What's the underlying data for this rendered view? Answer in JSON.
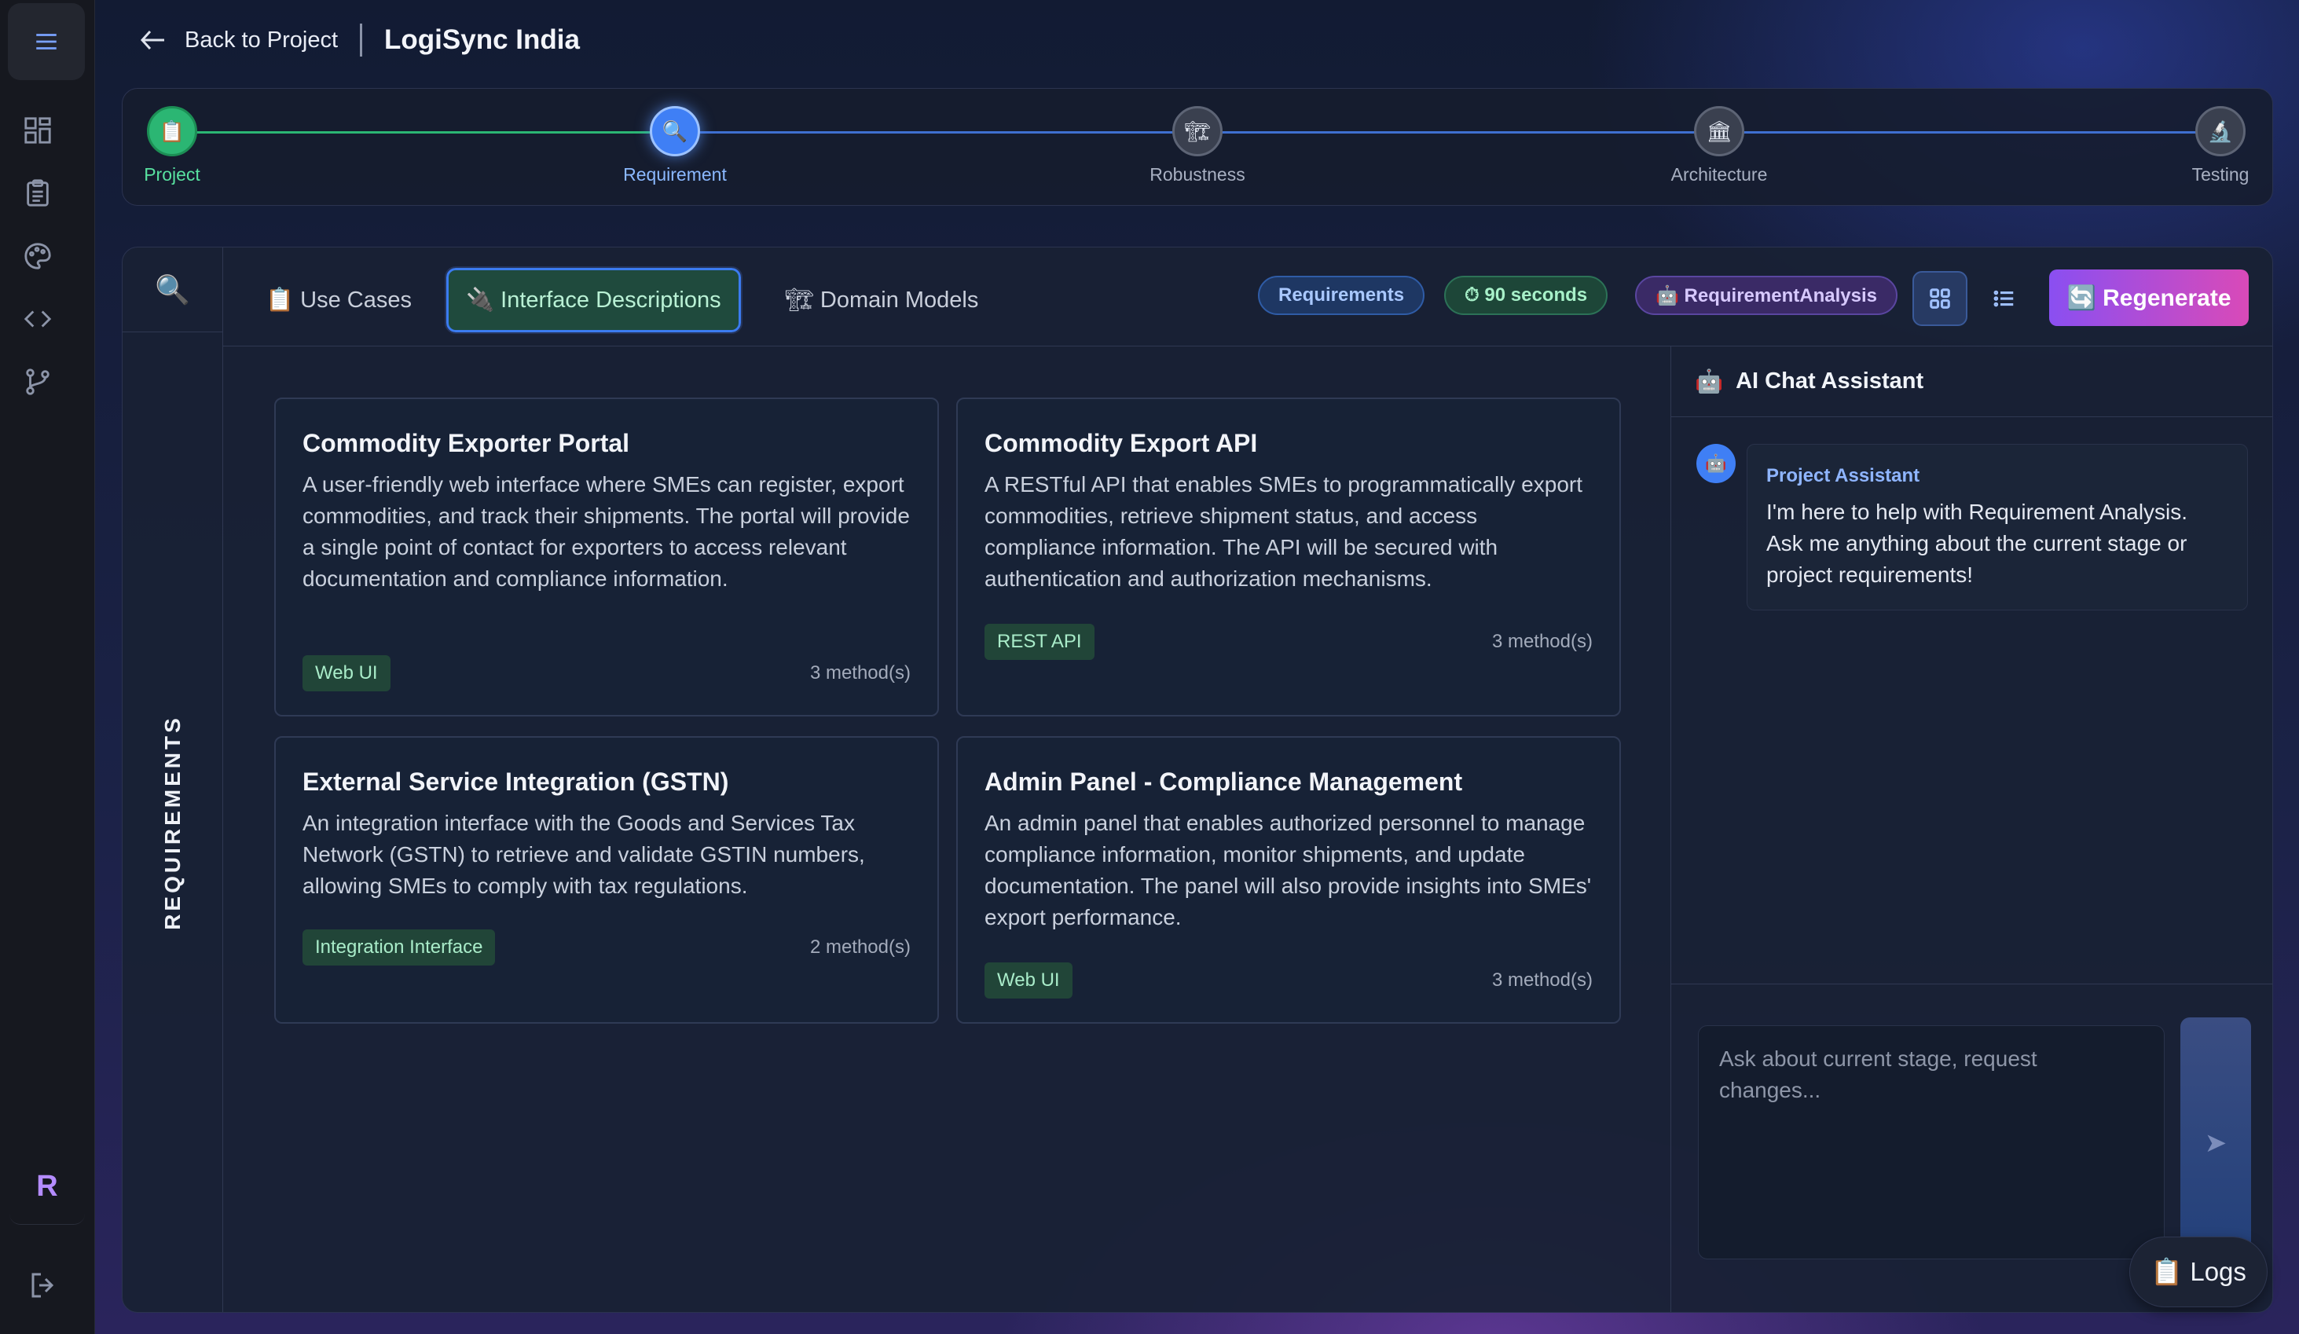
{
  "header": {
    "back_label": "Back to Project",
    "project_title": "LogiSync India"
  },
  "stepper": {
    "steps": [
      {
        "label": "Project",
        "icon": "📋",
        "state": "done"
      },
      {
        "label": "Requirement",
        "icon": "🔍",
        "state": "active"
      },
      {
        "label": "Robustness",
        "icon": "🏗",
        "state": "pending"
      },
      {
        "label": "Architecture",
        "icon": "🏛",
        "state": "pending"
      },
      {
        "label": "Testing",
        "icon": "🔬",
        "state": "pending"
      }
    ]
  },
  "sidebar": {
    "avatar_letter": "R"
  },
  "panel": {
    "vertical_label": "REQUIREMENTS",
    "search_icon": "🔍",
    "tabs": [
      {
        "icon": "📋",
        "label": "Use Cases"
      },
      {
        "icon": "🔌",
        "label": "Interface Descriptions"
      },
      {
        "icon": "🏗",
        "label": "Domain Models"
      }
    ],
    "badges": {
      "requirements": "Requirements",
      "time": "⏱ 90 seconds",
      "analysis": "🤖 RequirementAnalysis"
    },
    "regenerate_label": "🔄 Regenerate"
  },
  "cards": [
    {
      "title": "Commodity Exporter Portal",
      "description": "A user-friendly web interface where SMEs can register, export commodities, and track their shipments. The portal will provide a single point of contact for exporters to access relevant documentation and compliance information.",
      "tag": "Web UI",
      "methods": "3 method(s)"
    },
    {
      "title": "Commodity Export API",
      "description": "A RESTful API that enables SMEs to programmatically export commodities, retrieve shipment status, and access compliance information. The API will be secured with authentication and authorization mechanisms.",
      "tag": "REST API",
      "methods": "3 method(s)"
    },
    {
      "title": "External Service Integration (GSTN)",
      "description": "An integration interface with the Goods and Services Tax Network (GSTN) to retrieve and validate GSTIN numbers, allowing SMEs to comply with tax regulations.",
      "tag": "Integration Interface",
      "methods": "2 method(s)"
    },
    {
      "title": "Admin Panel - Compliance Management",
      "description": "An admin panel that enables authorized personnel to manage compliance information, monitor shipments, and update documentation. The panel will also provide insights into SMEs' export performance.",
      "tag": "Web UI",
      "methods": "3 method(s)"
    }
  ],
  "chat": {
    "title": "AI Chat Assistant",
    "title_icon": "🤖",
    "assistant_name": "Project Assistant",
    "assistant_message": "I'm here to help with Requirement Analysis. Ask me anything about the current stage or project requirements!",
    "input_placeholder": "Ask about current stage, request changes...",
    "send_icon": "➤"
  },
  "logs": {
    "label": "📋 Logs"
  }
}
